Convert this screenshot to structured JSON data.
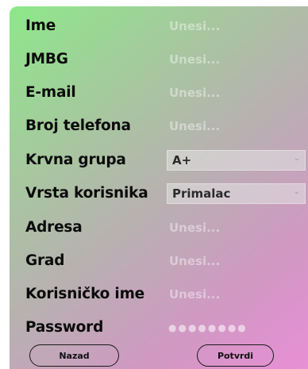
{
  "form": {
    "fields": [
      {
        "label": "Ime",
        "placeholder": "Unesi..."
      },
      {
        "label": "JMBG",
        "placeholder": "Unesi..."
      },
      {
        "label": "E-mail",
        "placeholder": "Unesi..."
      },
      {
        "label": "Broj telefona",
        "placeholder": "Unesi..."
      },
      {
        "label": "Krvna grupa",
        "value": "A+"
      },
      {
        "label": "Vrsta korisnika",
        "value": "Primalac"
      },
      {
        "label": "Adresa",
        "placeholder": "Unesi..."
      },
      {
        "label": "Grad",
        "placeholder": "Unesi..."
      },
      {
        "label": "Korisničko ime",
        "placeholder": "Unesi..."
      },
      {
        "label": "Password",
        "value": "●●●●●●●●"
      }
    ],
    "buttons": {
      "back_label": "Nazad",
      "confirm_label": "Potvrdi"
    }
  },
  "icons": {
    "dropdown": "chevron-down-icon"
  },
  "colors": {
    "gradient_start": "#8de88a",
    "gradient_end": "#e88fd6"
  }
}
